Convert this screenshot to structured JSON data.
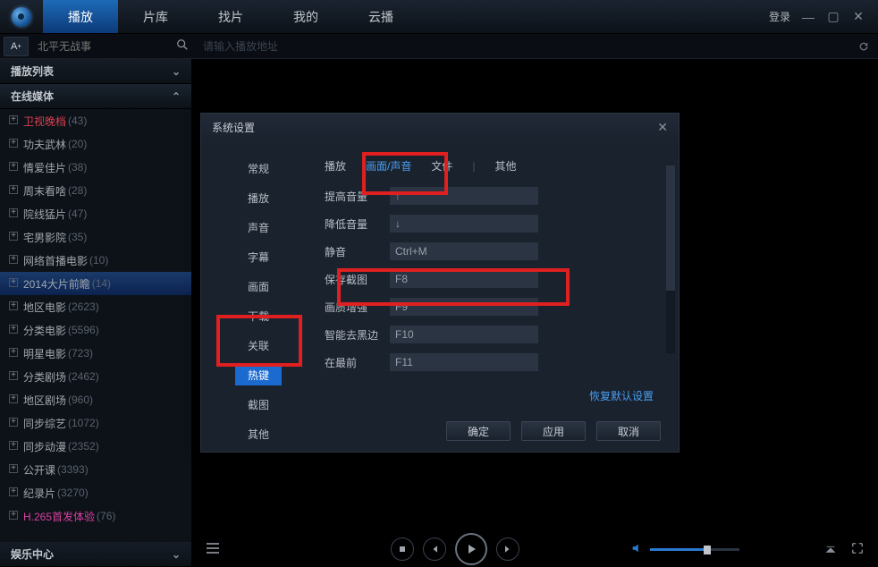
{
  "topnav": {
    "items": [
      "播放",
      "片库",
      "找片",
      "我的",
      "云播"
    ],
    "login": "登录"
  },
  "search": {
    "placeholder": "北平无战事"
  },
  "addr": {
    "placeholder": "请输入播放地址"
  },
  "sidebar": {
    "playlist_header": "播放列表",
    "online_header": "在线媒体",
    "entertainment_header": "娱乐中心",
    "items": [
      {
        "label": "卫视晚档",
        "count": "(43)",
        "red": true
      },
      {
        "label": "功夫武林",
        "count": "(20)"
      },
      {
        "label": "情爱佳片",
        "count": "(38)"
      },
      {
        "label": "周末看啥",
        "count": "(28)"
      },
      {
        "label": "院线猛片",
        "count": "(47)"
      },
      {
        "label": "宅男影院",
        "count": "(35)"
      },
      {
        "label": "网络首播电影",
        "count": "(10)"
      },
      {
        "label": "2014大片前瞻",
        "count": "(14)",
        "selected": true
      },
      {
        "label": "地区电影",
        "count": "(2623)"
      },
      {
        "label": "分类电影",
        "count": "(5596)"
      },
      {
        "label": "明星电影",
        "count": "(723)"
      },
      {
        "label": "分类剧场",
        "count": "(2462)"
      },
      {
        "label": "地区剧场",
        "count": "(960)"
      },
      {
        "label": "同步综艺",
        "count": "(1072)"
      },
      {
        "label": "同步动漫",
        "count": "(2352)"
      },
      {
        "label": "公开课",
        "count": "(3393)"
      },
      {
        "label": "纪录片",
        "count": "(3270)"
      },
      {
        "label": "H.265首发体验",
        "count": "(76)",
        "pink": true
      }
    ]
  },
  "dialog": {
    "title": "系统设置",
    "left": [
      "常规",
      "播放",
      "声音",
      "字幕",
      "画面",
      "下载",
      "关联",
      "热键",
      "截图",
      "其他"
    ],
    "left_active": "热键",
    "tabs": [
      "播放",
      "画面/声音",
      "文件",
      "其他"
    ],
    "tab_active": "画面/声音",
    "rows": [
      {
        "label": "提高音量",
        "value": "↑"
      },
      {
        "label": "降低音量",
        "value": "↓"
      },
      {
        "label": "静音",
        "value": "Ctrl+M"
      },
      {
        "label": "保存截图",
        "value": "F8"
      },
      {
        "label": "画质增强",
        "value": "F9"
      },
      {
        "label": "智能去黑边",
        "value": "F10"
      },
      {
        "label": "在最前",
        "value": "F11"
      }
    ],
    "restore": "恢复默认设置",
    "ok": "确定",
    "apply": "应用",
    "cancel": "取消"
  }
}
